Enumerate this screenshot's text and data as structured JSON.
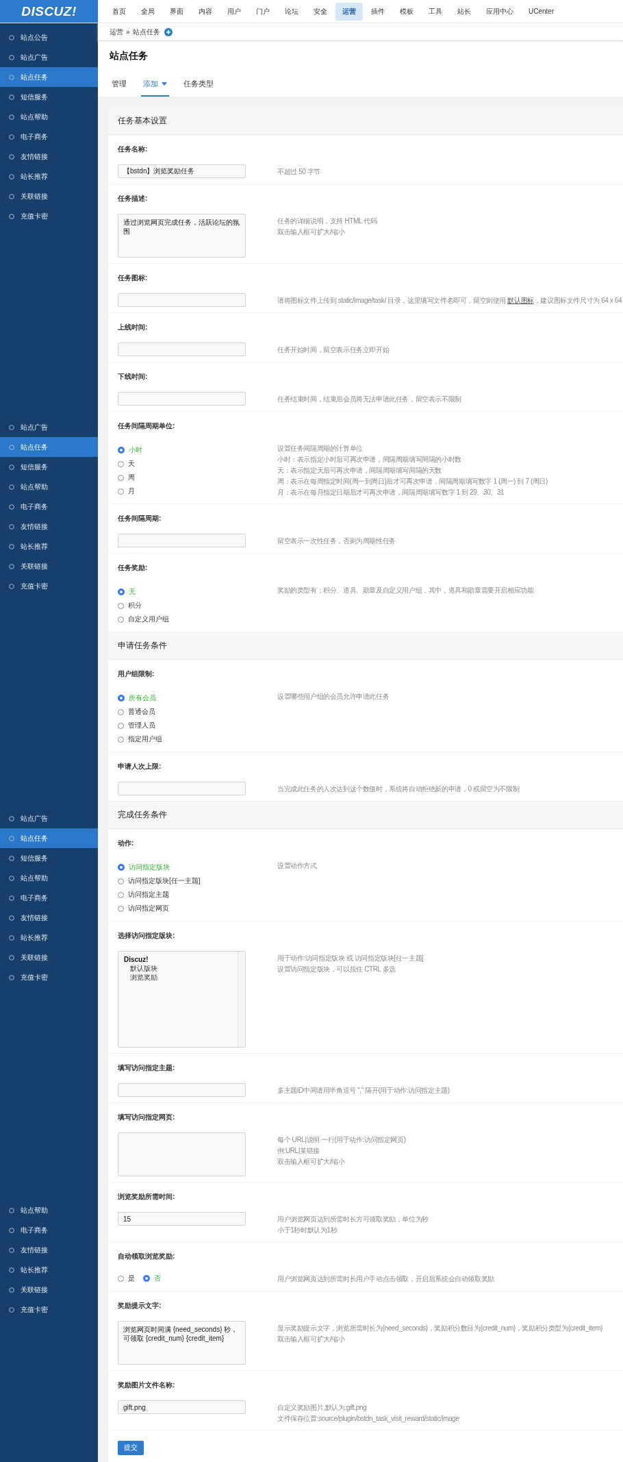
{
  "logo": "DISCUZ!",
  "nav": [
    {
      "label": "首页",
      "selected": false
    },
    {
      "label": "全局",
      "selected": false
    },
    {
      "label": "界面",
      "selected": false
    },
    {
      "label": "内容",
      "selected": false
    },
    {
      "label": "用户",
      "selected": false
    },
    {
      "label": "门户",
      "selected": false
    },
    {
      "label": "论坛",
      "selected": false
    },
    {
      "label": "安全",
      "selected": false
    },
    {
      "label": "运营",
      "selected": true
    },
    {
      "label": "插件",
      "selected": false
    },
    {
      "label": "模板",
      "selected": false
    },
    {
      "label": "工具",
      "selected": false
    },
    {
      "label": "站长",
      "selected": false
    },
    {
      "label": "应用中心",
      "selected": false
    },
    {
      "label": "UCenter",
      "selected": false
    }
  ],
  "sidebar": {
    "groups": [
      {
        "items": [
          {
            "label": "站点公告",
            "selected": false
          },
          {
            "label": "站点广告",
            "selected": false
          },
          {
            "label": "站点任务",
            "selected": true
          },
          {
            "label": "短信服务",
            "selected": false
          },
          {
            "label": "站点帮助",
            "selected": false
          },
          {
            "label": "电子商务",
            "selected": false
          },
          {
            "label": "友情链接",
            "selected": false
          },
          {
            "label": "站长推荐",
            "selected": false
          },
          {
            "label": "关联链接",
            "selected": false
          },
          {
            "label": "充值卡密",
            "selected": false
          }
        ]
      },
      {
        "items": [
          {
            "label": "站点广告",
            "selected": false
          },
          {
            "label": "站点任务",
            "selected": true
          },
          {
            "label": "短信服务",
            "selected": false
          },
          {
            "label": "站点帮助",
            "selected": false
          },
          {
            "label": "电子商务",
            "selected": false
          },
          {
            "label": "友情链接",
            "selected": false
          },
          {
            "label": "站长推荐",
            "selected": false
          },
          {
            "label": "关联链接",
            "selected": false
          },
          {
            "label": "充值卡密",
            "selected": false
          }
        ]
      },
      {
        "items": [
          {
            "label": "站点广告",
            "selected": false
          },
          {
            "label": "站点任务",
            "selected": true
          },
          {
            "label": "短信服务",
            "selected": false
          },
          {
            "label": "站点帮助",
            "selected": false
          },
          {
            "label": "电子商务",
            "selected": false
          },
          {
            "label": "友情链接",
            "selected": false
          },
          {
            "label": "站长推荐",
            "selected": false
          },
          {
            "label": "关联链接",
            "selected": false
          },
          {
            "label": "充值卡密",
            "selected": false
          }
        ]
      },
      {
        "items": [
          {
            "label": "站点帮助",
            "selected": false
          },
          {
            "label": "电子商务",
            "selected": false
          },
          {
            "label": "友情链接",
            "selected": false
          },
          {
            "label": "站长推荐",
            "selected": false
          },
          {
            "label": "关联链接",
            "selected": false
          },
          {
            "label": "充值卡密",
            "selected": false
          }
        ]
      }
    ]
  },
  "breadcrumb": {
    "parent": "运营",
    "separator": "»",
    "current": "站点任务"
  },
  "page_title": "站点任务",
  "tabs": [
    {
      "label": "管理",
      "selected": false,
      "dropdown": false
    },
    {
      "label": "添加",
      "selected": true,
      "dropdown": true
    },
    {
      "label": "任务类型",
      "selected": false,
      "dropdown": false
    }
  ],
  "sections": [
    {
      "title": "任务基本设置",
      "rows": [
        {
          "label": "任务名称:",
          "kind": "input",
          "value": "【bstdn】浏览奖励任务",
          "hint": [
            "不超过 50 字节"
          ]
        },
        {
          "label": "任务描述:",
          "kind": "textarea",
          "value": "通过浏览网页完成任务，活跃论坛的氛围",
          "hint": [
            "任务的详细说明，支持 HTML 代码",
            "双击输入框可扩大/缩小"
          ]
        },
        {
          "label": "任务图标:",
          "kind": "input",
          "hint": [
            {
              "before": "请将图标文件上传到 static/image/task/ 目录，这里填写文件名即可，留空则使用 ",
              "link": "默认图标",
              "after": "，建议图标文件尺寸为 64 x 64"
            }
          ]
        },
        {
          "label": "上线时间:",
          "kind": "input",
          "hint": [
            "任务开始时间，留空表示任务立即开始"
          ]
        },
        {
          "label": "下线时间:",
          "kind": "input",
          "hint": [
            "任务结束时间，结束后会员将无法申请此任务，留空表示不限制"
          ]
        },
        {
          "label": "任务间隔周期单位:",
          "kind": "radio",
          "options": [
            {
              "label": "小时",
              "selected": true
            },
            {
              "label": "天",
              "selected": false
            },
            {
              "label": "周",
              "selected": false
            },
            {
              "label": "月",
              "selected": false
            }
          ],
          "hint": [
            "设置任务间隔周期的计算单位",
            "小时：表示指定小时后可再次申请，间隔周期填写间隔的小时数",
            "天：表示指定天后可再次申请，间隔周期填写间隔的天数",
            "周：表示在每周指定时间(周一到周日)后才可再次申请，间隔周期填写数字 1 (周一) 到 7 (周日)",
            "月：表示在每月指定日期后才可再次申请，间隔周期填写数字 1 到 29、30、31"
          ]
        },
        {
          "label": "任务间隔周期:",
          "kind": "input",
          "hint": [
            "留空表示一次性任务，否则为周期性任务"
          ]
        },
        {
          "label": "任务奖励:",
          "kind": "radio",
          "options": [
            {
              "label": "无",
              "selected": true
            },
            {
              "label": "积分",
              "selected": false
            },
            {
              "label": "自定义用户组",
              "selected": false
            }
          ],
          "hint": [
            "奖励的类型有：积分、道具、勋章及自定义用户组，其中，道具和勋章需要开启相应功能"
          ]
        }
      ]
    },
    {
      "title": "申请任务条件",
      "rows": [
        {
          "label": "用户组限制:",
          "kind": "radio",
          "options": [
            {
              "label": "所有会员",
              "selected": true
            },
            {
              "label": "普通会员",
              "selected": false
            },
            {
              "label": "管理人员",
              "selected": false
            },
            {
              "label": "指定用户组",
              "selected": false
            }
          ],
          "hint": [
            "设置哪些用户组的会员允许申请此任务"
          ]
        },
        {
          "label": "申请人次上限:",
          "kind": "input",
          "hint": [
            "当完成此任务的人次达到这个数值时，系统将自动拒绝新的申请，0 或留空为不限制"
          ]
        }
      ]
    },
    {
      "title": "完成任务条件",
      "rows": [
        {
          "label": "动作:",
          "kind": "radio",
          "options": [
            {
              "label": "访问指定版块",
              "selected": true
            },
            {
              "label": "访问指定版块[任一主题]",
              "selected": false
            },
            {
              "label": "访问指定主题",
              "selected": false
            },
            {
              "label": "访问指定网页",
              "selected": false
            }
          ],
          "hint": [
            "设置动作方式"
          ]
        },
        {
          "label": "选择访问指定版块:",
          "kind": "listbox",
          "options": [
            {
              "label": "Discuz!",
              "group": true
            },
            {
              "label": "默认版块",
              "group": false
            },
            {
              "label": "浏览奖励",
              "group": false
            }
          ],
          "hint": [
            "用于动作:访问指定版块 或 访问指定版块[任一主题]",
            "设置访问指定版块，可以按住 CTRL 多选"
          ]
        },
        {
          "label": "填写访问指定主题:",
          "kind": "input",
          "hint": [
            "多主题ID中间请用半角逗号 \",\" 隔开(用于动作:访问指定主题)"
          ]
        },
        {
          "label": "填写访问指定网页:",
          "kind": "textarea",
          "hint": [
            "每个 URL|说明 一行(用于动作:访问指定网页)",
            "例:URL|某链接",
            "双击输入框可扩大/缩小"
          ]
        },
        {
          "label": "浏览奖励所需时间:",
          "kind": "input",
          "value": "15",
          "hint": [
            "用户浏览网页达到所需时长方可领取奖励，单位为秒",
            "小于1秒时默认为1秒"
          ]
        },
        {
          "label": "自动领取浏览奖励:",
          "kind": "radio_inline",
          "options": [
            {
              "label": "是",
              "selected": false
            },
            {
              "label": "否",
              "selected": true
            }
          ],
          "hint": [
            "用户浏览网页达到所需时长用户手动点击领取，开启后系统会自动领取奖励"
          ]
        },
        {
          "label": "奖励提示文字:",
          "kind": "textarea",
          "value": "浏览网页时间满 {need_seconds} 秒，可领取 {credit_num} {credit_item}",
          "hint": [
            "显示奖励提示文字，浏览所需时长为{need_seconds}，奖励积分数目为{credit_num}，奖励积分类型为{credit_item}",
            "双击输入框可扩大/缩小"
          ]
        },
        {
          "label": "奖励图片文件名称:",
          "kind": "input",
          "value": "gift.png",
          "hint": [
            "自定义奖励图片,默认为:gift.png",
            "文件保存位置:source/plugin/bstdn_task_visit_reward/static/image"
          ]
        }
      ]
    }
  ],
  "submit": "提交"
}
